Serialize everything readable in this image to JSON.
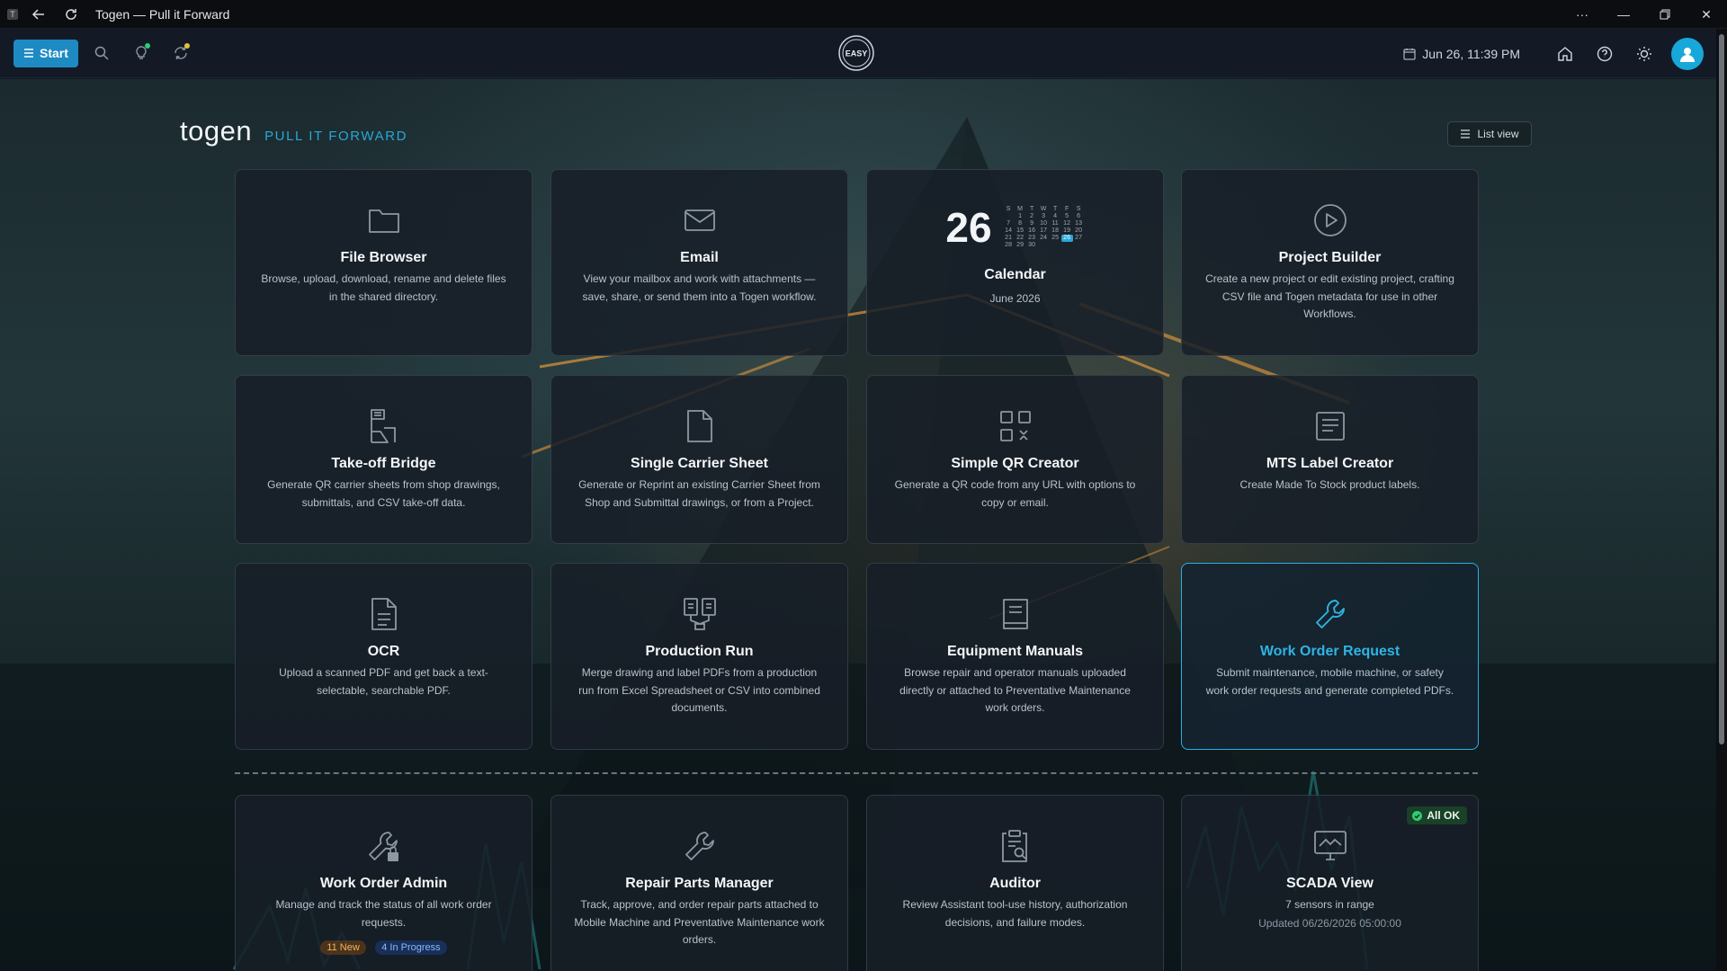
{
  "window": {
    "title": "Togen — Pull it Forward"
  },
  "header": {
    "start_label": "Start",
    "datetime": "Jun 26, 11:39 PM",
    "logo_text": "EASY"
  },
  "brand": {
    "name": "togen",
    "tagline": "PULL IT FORWARD"
  },
  "view_toggle": {
    "label": "List view"
  },
  "calendar": {
    "day": "26",
    "month_label": "June 2026",
    "weekday_headers": [
      "S",
      "M",
      "T",
      "W",
      "T",
      "F",
      "S"
    ],
    "weeks": [
      [
        "",
        "1",
        "2",
        "3",
        "4",
        "5",
        "6"
      ],
      [
        "7",
        "8",
        "9",
        "10",
        "11",
        "12",
        "13"
      ],
      [
        "14",
        "15",
        "16",
        "17",
        "18",
        "19",
        "20"
      ],
      [
        "21",
        "22",
        "23",
        "24",
        "25",
        "26",
        "27"
      ],
      [
        "28",
        "29",
        "30",
        "",
        "",
        "",
        ""
      ]
    ],
    "today": "26"
  },
  "tiles": [
    {
      "id": "file-browser",
      "icon": "folder-icon",
      "title": "File Browser",
      "desc": "Browse, upload, download, rename and delete files in the shared directory."
    },
    {
      "id": "email",
      "icon": "mail-icon",
      "title": "Email",
      "desc": "View your mailbox and work with attachments — save, share, or send them into a Togen workflow."
    },
    {
      "id": "calendar",
      "icon": "calendar-icon",
      "title": "Calendar",
      "desc": "June 2026"
    },
    {
      "id": "project-builder",
      "icon": "play-circle-icon",
      "title": "Project Builder",
      "desc": "Create a new project or edit existing project, crafting CSV file and Togen metadata for use in other Workflows."
    },
    {
      "id": "take-off-bridge",
      "icon": "document-bridge-icon",
      "title": "Take-off Bridge",
      "desc": "Generate QR carrier sheets from shop drawings, submittals, and CSV take-off data."
    },
    {
      "id": "single-carrier-sheet",
      "icon": "file-icon",
      "title": "Single Carrier Sheet",
      "desc": "Generate or Reprint an existing Carrier Sheet from Shop and Submittal drawings, or from a Project."
    },
    {
      "id": "simple-qr-creator",
      "icon": "qr-code-icon",
      "title": "Simple QR Creator",
      "desc": "Generate a QR code from any URL with options to copy or email."
    },
    {
      "id": "mts-label-creator",
      "icon": "label-icon",
      "title": "MTS Label Creator",
      "desc": "Create Made To Stock product labels."
    },
    {
      "id": "ocr",
      "icon": "file-text-icon",
      "title": "OCR",
      "desc": "Upload a scanned PDF and get back a text-selectable, searchable PDF."
    },
    {
      "id": "production-run",
      "icon": "merge-documents-icon",
      "title": "Production Run",
      "desc": "Merge drawing and label PDFs from a production run from Excel Spreadsheet or CSV into combined documents."
    },
    {
      "id": "equipment-manuals",
      "icon": "book-icon",
      "title": "Equipment Manuals",
      "desc": "Browse repair and operator manuals uploaded directly or attached to Preventative Maintenance work orders."
    },
    {
      "id": "work-order-request",
      "icon": "wrench-icon",
      "title": "Work Order Request",
      "desc": "Submit maintenance, mobile machine, or safety work order requests and generate completed PDFs."
    },
    {
      "id": "work-order-admin",
      "icon": "wrench-admin-icon",
      "title": "Work Order Admin",
      "desc": "Manage and track the status of all work order requests."
    },
    {
      "id": "repair-parts-manager",
      "icon": "wrench-icon",
      "title": "Repair Parts Manager",
      "desc": "Track, approve, and order repair parts attached to Mobile Machine and Preventative Maintenance work orders."
    },
    {
      "id": "auditor",
      "icon": "clipboard-search-icon",
      "title": "Auditor",
      "desc": "Review Assistant tool-use history, authorization decisions, and failure modes."
    },
    {
      "id": "scada-view",
      "icon": "monitor-chart-icon",
      "title": "SCADA View",
      "desc": "7 sensors in range",
      "sub": "Updated 06/26/2026 05:00:00"
    }
  ],
  "work_order_badges": {
    "new": "11 New",
    "in_progress": "4 In Progress"
  },
  "scada_status": "All OK",
  "colors": {
    "accent": "#1d8ac4",
    "accent_light": "#2ab0e0",
    "status_ok": "#2ecc71"
  }
}
